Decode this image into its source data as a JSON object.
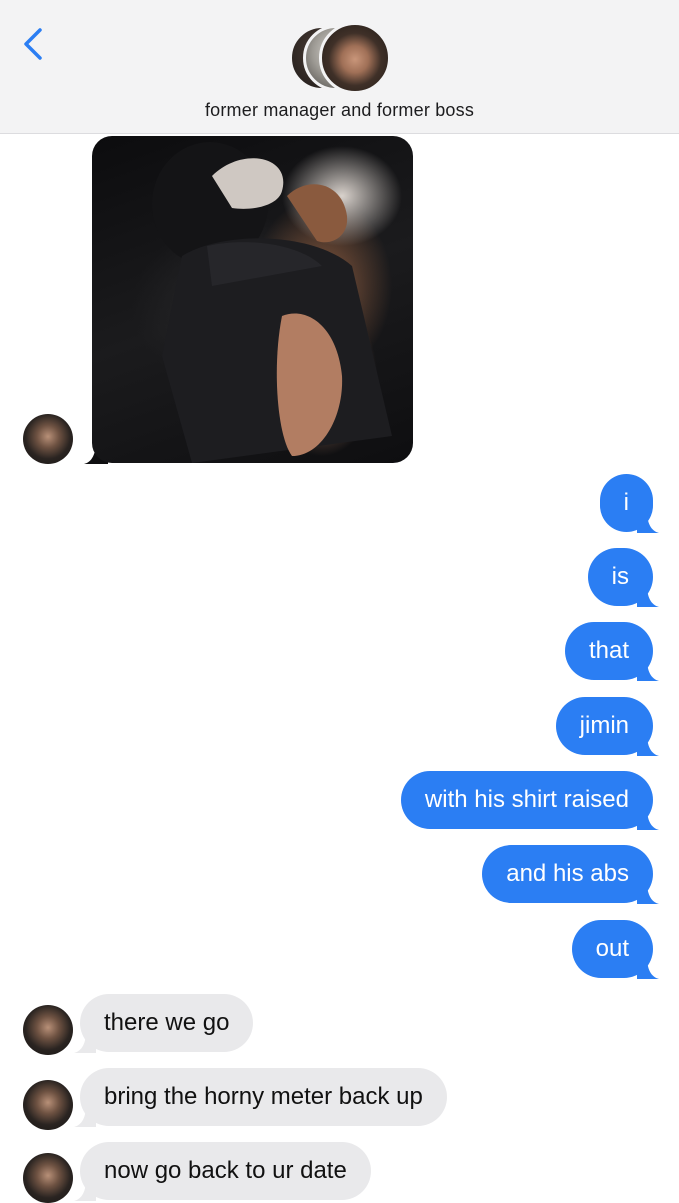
{
  "header": {
    "title": "former manager and former boss",
    "back_icon": "chevron-left-icon",
    "accent": "#2b7ef3"
  },
  "photo": {
    "description_icon": "image-attachment"
  },
  "outgoing_color": "#2b7ef3",
  "incoming_color": "#e9e9eb",
  "messages_out": [
    "i",
    "is",
    "that",
    "jimin",
    "with his shirt raised",
    "and his abs",
    "out"
  ],
  "messages_in": [
    "there we go",
    "bring the horny meter back up",
    "now go back to ur date"
  ]
}
